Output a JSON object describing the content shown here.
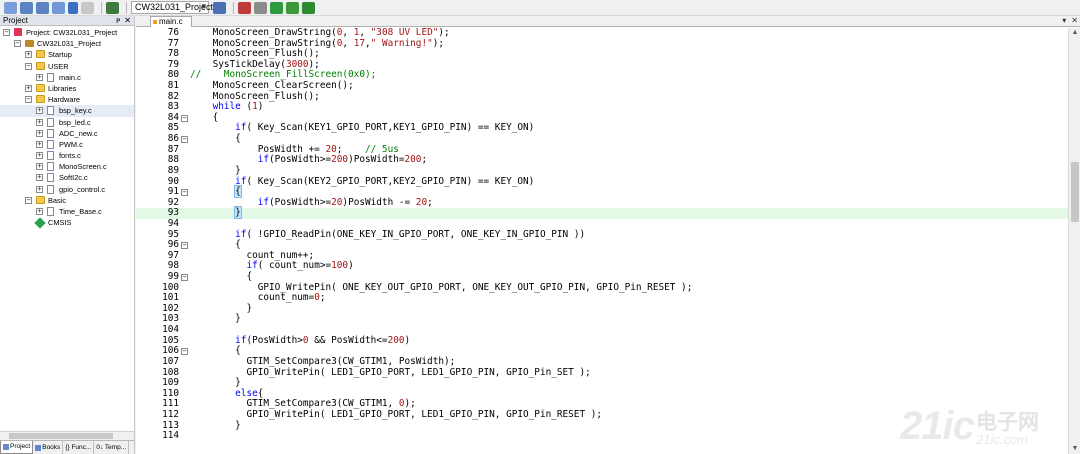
{
  "toolbar": {
    "target_select": "CW32L031_Project",
    "buttons_left": [
      "load-icon",
      "save-icon",
      "save-all-icon",
      "open-icon",
      "dropdown-icon",
      "grey-icon"
    ],
    "buttons_right": [
      "options-icon",
      "magic-wand-icon",
      "translate-icon",
      "build-icon",
      "rebuild-icon",
      "batch-icon",
      "download-icon",
      "debug-icon"
    ]
  },
  "project_panel": {
    "title": "Project",
    "pin": "ᴘ",
    "close": "✕",
    "tree": [
      {
        "label": "Project: CW32L031_Project",
        "indent": 0,
        "icon": "proj",
        "toggle": "−"
      },
      {
        "label": "CW32L031_Project",
        "indent": 1,
        "icon": "target",
        "toggle": "−"
      },
      {
        "label": "Startup",
        "indent": 2,
        "icon": "folder",
        "toggle": "+"
      },
      {
        "label": "USER",
        "indent": 2,
        "icon": "folder",
        "toggle": "−"
      },
      {
        "label": "main.c",
        "indent": 3,
        "icon": "file",
        "toggle": "+"
      },
      {
        "label": "Libraries",
        "indent": 2,
        "icon": "folder",
        "toggle": "+"
      },
      {
        "label": "Hardware",
        "indent": 2,
        "icon": "folder",
        "toggle": "−"
      },
      {
        "label": "bsp_key.c",
        "indent": 3,
        "icon": "file",
        "toggle": "+",
        "selected": true
      },
      {
        "label": "bsp_led.c",
        "indent": 3,
        "icon": "file",
        "toggle": "+"
      },
      {
        "label": "ADC_new.c",
        "indent": 3,
        "icon": "file",
        "toggle": "+"
      },
      {
        "label": "PWM.c",
        "indent": 3,
        "icon": "file",
        "toggle": "+"
      },
      {
        "label": "fonts.c",
        "indent": 3,
        "icon": "file",
        "toggle": "+"
      },
      {
        "label": "MonoScreen.c",
        "indent": 3,
        "icon": "file",
        "toggle": "+"
      },
      {
        "label": "SoftI2c.c",
        "indent": 3,
        "icon": "file",
        "toggle": "+"
      },
      {
        "label": "gpio_control.c",
        "indent": 3,
        "icon": "file",
        "toggle": "+"
      },
      {
        "label": "Basic",
        "indent": 2,
        "icon": "folder",
        "toggle": "−"
      },
      {
        "label": "Time_Base.c",
        "indent": 3,
        "icon": "file",
        "toggle": "+"
      },
      {
        "label": "CMSIS",
        "indent": 2,
        "icon": "cmsis",
        "toggle": ""
      }
    ],
    "tabs": [
      "Project",
      "Books",
      "{} Func...",
      "0↓ Temp..."
    ]
  },
  "editor": {
    "active_tab": "main.c",
    "tab_actions": [
      "▾",
      "✕"
    ],
    "scroll_up": "▲",
    "scroll_down": "▼",
    "lines": [
      {
        "n": "76",
        "fold": "",
        "code": "    MonoScreen_DrawString(0, 1, \"308 UV LED\");"
      },
      {
        "n": "77",
        "fold": "",
        "code": "    MonoScreen_DrawString(0, 17,\" Warning!\");"
      },
      {
        "n": "78",
        "fold": "",
        "code": "    MonoScreen_Flush();"
      },
      {
        "n": "79",
        "fold": "",
        "code": "    SysTickDelay(3000);"
      },
      {
        "n": "80",
        "fold": "",
        "code": "//    MonoScreen_FillScreen(0x0);"
      },
      {
        "n": "81",
        "fold": "",
        "code": "    MonoScreen_ClearScreen();"
      },
      {
        "n": "82",
        "fold": "",
        "code": "    MonoScreen_Flush();"
      },
      {
        "n": "83",
        "fold": "",
        "code": "    while (1)"
      },
      {
        "n": "84",
        "fold": "−",
        "code": "    {"
      },
      {
        "n": "85",
        "fold": "",
        "code": "        if( Key_Scan(KEY1_GPIO_PORT,KEY1_GPIO_PIN) == KEY_ON)"
      },
      {
        "n": "86",
        "fold": "−",
        "code": "        {"
      },
      {
        "n": "87",
        "fold": "",
        "code": "            PosWidth += 20;    // 5us"
      },
      {
        "n": "88",
        "fold": "",
        "code": "            if(PosWidth>=200)PosWidth=200;"
      },
      {
        "n": "89",
        "fold": "",
        "code": "        }"
      },
      {
        "n": "90",
        "fold": "",
        "code": "        if( Key_Scan(KEY2_GPIO_PORT,KEY2_GPIO_PIN) == KEY_ON)"
      },
      {
        "n": "91",
        "fold": "−",
        "code": "        {"
      },
      {
        "n": "92",
        "fold": "",
        "code": "            if(PosWidth>=20)PosWidth -= 20;"
      },
      {
        "n": "93",
        "fold": "",
        "code": "        }",
        "highlight": true
      },
      {
        "n": "94",
        "fold": "",
        "code": ""
      },
      {
        "n": "95",
        "fold": "",
        "code": "        if( !GPIO_ReadPin(ONE_KEY_IN_GPIO_PORT, ONE_KEY_IN_GPIO_PIN ))"
      },
      {
        "n": "96",
        "fold": "−",
        "code": "        {"
      },
      {
        "n": "97",
        "fold": "",
        "code": "          count_num++;"
      },
      {
        "n": "98",
        "fold": "",
        "code": "          if( count_num>=100)"
      },
      {
        "n": "99",
        "fold": "−",
        "code": "          {"
      },
      {
        "n": "100",
        "fold": "",
        "code": "            GPIO_WritePin( ONE_KEY_OUT_GPIO_PORT, ONE_KEY_OUT_GPIO_PIN, GPIO_Pin_RESET );"
      },
      {
        "n": "101",
        "fold": "",
        "code": "            count_num=0;"
      },
      {
        "n": "102",
        "fold": "",
        "code": "          }"
      },
      {
        "n": "103",
        "fold": "",
        "code": "        }"
      },
      {
        "n": "104",
        "fold": "",
        "code": ""
      },
      {
        "n": "105",
        "fold": "",
        "code": "        if(PosWidth>0 && PosWidth<=200)"
      },
      {
        "n": "106",
        "fold": "−",
        "code": "        {"
      },
      {
        "n": "107",
        "fold": "",
        "code": "          GTIM_SetCompare3(CW_GTIM1, PosWidth);"
      },
      {
        "n": "108",
        "fold": "",
        "code": "          GPIO_WritePin( LED1_GPIO_PORT, LED1_GPIO_PIN, GPIO_Pin_SET );"
      },
      {
        "n": "109",
        "fold": "",
        "code": "        }"
      },
      {
        "n": "110",
        "fold": "",
        "code": "        else{"
      },
      {
        "n": "111",
        "fold": "",
        "code": "          GTIM_SetCompare3(CW_GTIM1, 0);"
      },
      {
        "n": "112",
        "fold": "",
        "code": "          GPIO_WritePin( LED1_GPIO_PORT, LED1_GPIO_PIN, GPIO_Pin_RESET );"
      },
      {
        "n": "113",
        "fold": "",
        "code": "        }"
      },
      {
        "n": "114",
        "fold": "",
        "code": ""
      }
    ]
  },
  "watermark": {
    "main": "21ic",
    "cn": "电子网",
    "url": "21ic.com"
  },
  "colors": {
    "keyword": "#0000ff",
    "number": "#a31515",
    "comment": "#008000",
    "current_line": "#e3f9e6"
  }
}
